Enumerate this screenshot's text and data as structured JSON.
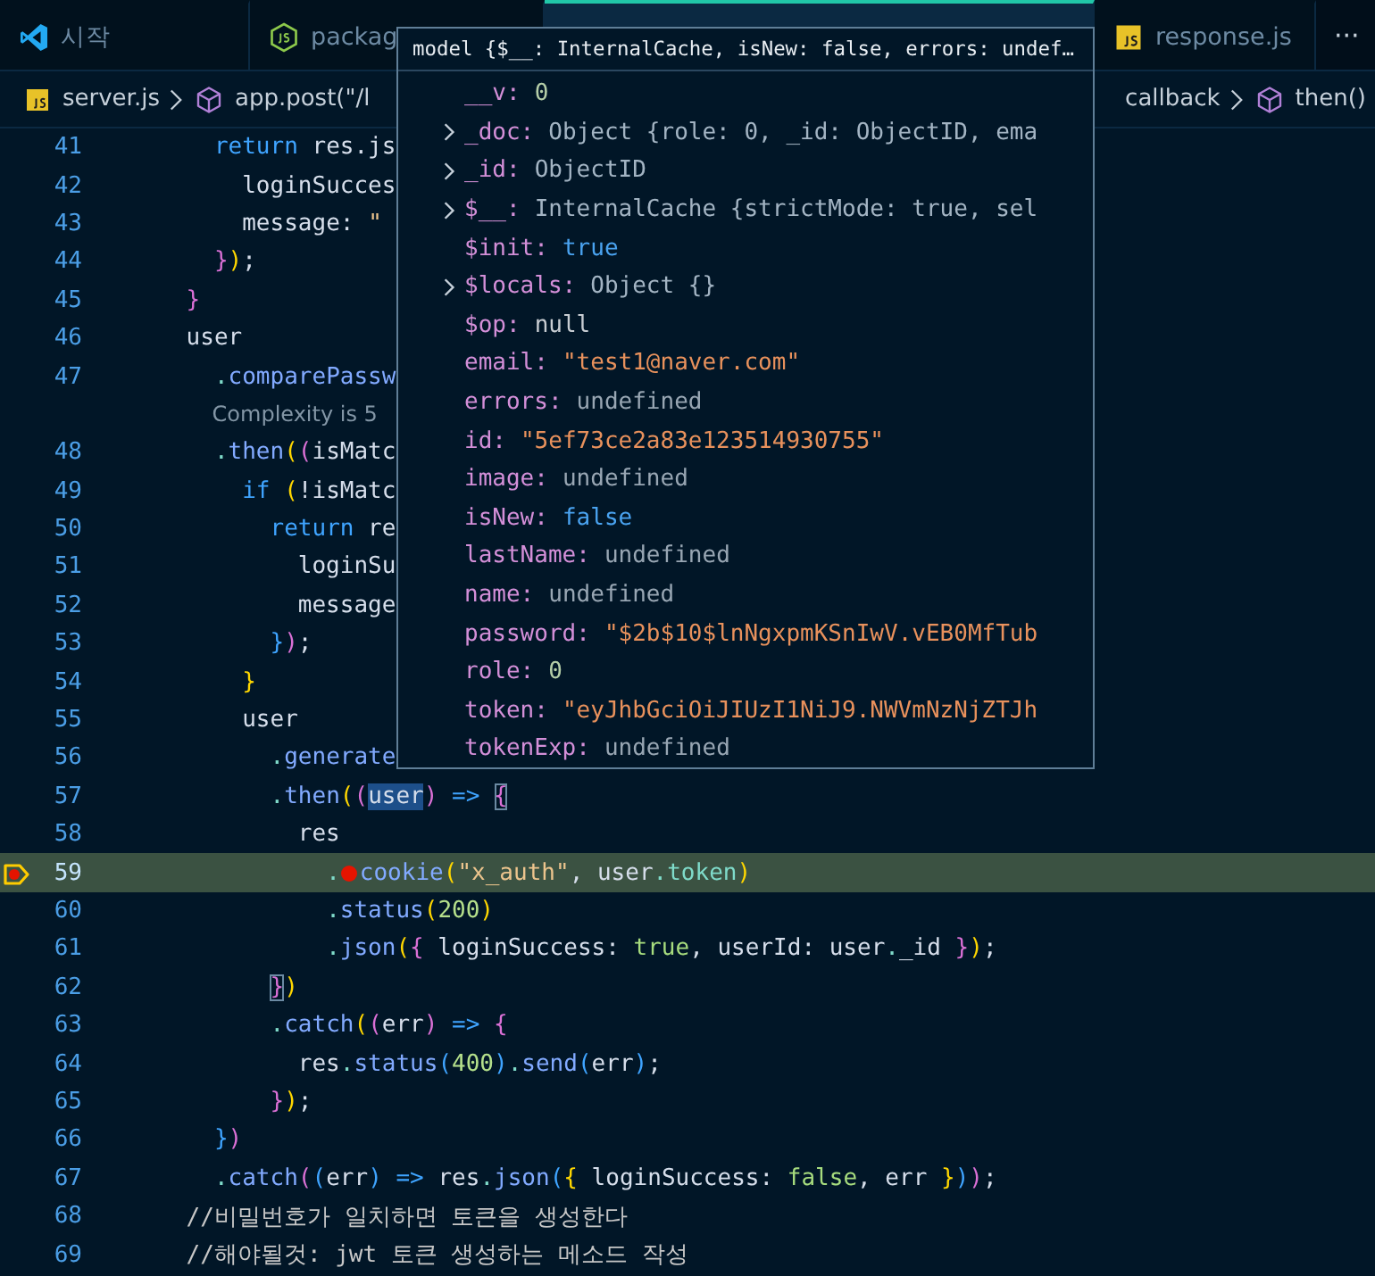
{
  "tabs": [
    {
      "label": "시작",
      "selected": false
    },
    {
      "label": "packag",
      "selected": false
    },
    {
      "selected": true
    },
    {
      "label": "response.js",
      "selected": false
    }
  ],
  "more_button": "···",
  "breadcrumbs": [
    {
      "label": "server.js"
    },
    {
      "label": "app.post(\"/l"
    },
    {
      "label": "callback"
    },
    {
      "label": "then()"
    }
  ],
  "lines": [
    {
      "kind": "code",
      "number": "41",
      "current": false,
      "breakpoint": false,
      "tokens": [
        {
          "text": "      return",
          "kind": "keyword"
        },
        {
          "text": " res.js",
          "kind": "plain"
        }
      ]
    },
    {
      "kind": "code",
      "number": "42",
      "current": false,
      "breakpoint": false,
      "tokens": [
        {
          "text": "        loginSucces",
          "kind": "plain"
        }
      ]
    },
    {
      "kind": "code",
      "number": "43",
      "current": false,
      "breakpoint": false,
      "tokens": [
        {
          "text": "        message",
          "kind": "plain"
        },
        {
          "text": ": ",
          "kind": "plain"
        },
        {
          "text": "\"",
          "kind": "string"
        }
      ]
    },
    {
      "kind": "code",
      "number": "44",
      "current": false,
      "breakpoint": false,
      "tokens": [
        {
          "text": "      }",
          "kind": "b2"
        },
        {
          "text": ")",
          "kind": "b1"
        },
        {
          "text": ";",
          "kind": "plain"
        }
      ]
    },
    {
      "kind": "code",
      "number": "45",
      "current": false,
      "breakpoint": false,
      "tokens": [
        {
          "text": "    }",
          "kind": "b2"
        }
      ]
    },
    {
      "kind": "code",
      "number": "46",
      "current": false,
      "breakpoint": false,
      "tokens": [
        {
          "text": "    user",
          "kind": "plain"
        }
      ]
    },
    {
      "kind": "code",
      "number": "47",
      "current": false,
      "breakpoint": false,
      "tokens": [
        {
          "text": "      .",
          "kind": "punct"
        },
        {
          "text": "comparePassw",
          "kind": "method"
        }
      ]
    },
    {
      "kind": "codelens",
      "text": "      Complexity is 5"
    },
    {
      "kind": "code",
      "number": "48",
      "current": false,
      "breakpoint": false,
      "tokens": [
        {
          "text": "      .",
          "kind": "punct"
        },
        {
          "text": "then",
          "kind": "method"
        },
        {
          "text": "(",
          "kind": "b1"
        },
        {
          "text": "(",
          "kind": "b2"
        },
        {
          "text": "isMatc",
          "kind": "plain"
        }
      ]
    },
    {
      "kind": "code",
      "number": "49",
      "current": false,
      "breakpoint": false,
      "tokens": [
        {
          "text": "        if",
          "kind": "keyword"
        },
        {
          "text": " (",
          "kind": "b1"
        },
        {
          "text": "!isMatc",
          "kind": "plain"
        }
      ]
    },
    {
      "kind": "code",
      "number": "50",
      "current": false,
      "breakpoint": false,
      "tokens": [
        {
          "text": "          return",
          "kind": "keyword"
        },
        {
          "text": " re",
          "kind": "plain"
        }
      ]
    },
    {
      "kind": "code",
      "number": "51",
      "current": false,
      "breakpoint": false,
      "tokens": [
        {
          "text": "            loginSu",
          "kind": "plain"
        }
      ]
    },
    {
      "kind": "code",
      "number": "52",
      "current": false,
      "breakpoint": false,
      "tokens": [
        {
          "text": "            message",
          "kind": "plain"
        }
      ]
    },
    {
      "kind": "code",
      "number": "53",
      "current": false,
      "breakpoint": false,
      "tokens": [
        {
          "text": "          }",
          "kind": "b3"
        },
        {
          "text": ")",
          "kind": "b2"
        },
        {
          "text": ";",
          "kind": "plain"
        }
      ]
    },
    {
      "kind": "code",
      "number": "54",
      "current": false,
      "breakpoint": false,
      "tokens": [
        {
          "text": "        }",
          "kind": "b1"
        }
      ]
    },
    {
      "kind": "code",
      "number": "55",
      "current": false,
      "breakpoint": false,
      "tokens": [
        {
          "text": "        user",
          "kind": "plain"
        }
      ]
    },
    {
      "kind": "code",
      "number": "56",
      "current": false,
      "breakpoint": false,
      "tokens": [
        {
          "text": "          .",
          "kind": "punct"
        },
        {
          "text": "generate",
          "kind": "method"
        }
      ]
    },
    {
      "kind": "code",
      "number": "57",
      "current": false,
      "breakpoint": false,
      "tokens": [
        {
          "text": "          .",
          "kind": "punct"
        },
        {
          "text": "then",
          "kind": "method"
        },
        {
          "text": "(",
          "kind": "b1"
        },
        {
          "text": "(",
          "kind": "b2"
        },
        {
          "text": "user",
          "kind": "selected"
        },
        {
          "text": ")",
          "kind": "b2"
        },
        {
          "text": " => ",
          "kind": "arrow"
        },
        {
          "text": "{",
          "kind": "match"
        }
      ]
    },
    {
      "kind": "code",
      "number": "58",
      "current": false,
      "breakpoint": false,
      "tokens": [
        {
          "text": "            res",
          "kind": "plain"
        }
      ]
    },
    {
      "kind": "code",
      "number": "59",
      "current": true,
      "breakpoint": true,
      "tokens": [
        {
          "text": "              .",
          "kind": "punct"
        },
        {
          "kind": "inline-breakpoint"
        },
        {
          "text": "cookie",
          "kind": "method"
        },
        {
          "text": "(",
          "kind": "b1"
        },
        {
          "text": "\"x_auth\"",
          "kind": "string"
        },
        {
          "text": ", user",
          "kind": "plain"
        },
        {
          "text": ".",
          "kind": "punct"
        },
        {
          "text": "token",
          "kind": "prop"
        },
        {
          "text": ")",
          "kind": "b1"
        }
      ]
    },
    {
      "kind": "code",
      "number": "60",
      "current": false,
      "breakpoint": false,
      "tokens": [
        {
          "text": "              .",
          "kind": "punct"
        },
        {
          "text": "status",
          "kind": "method"
        },
        {
          "text": "(",
          "kind": "b1"
        },
        {
          "text": "200",
          "kind": "number"
        },
        {
          "text": ")",
          "kind": "b1"
        }
      ]
    },
    {
      "kind": "code",
      "number": "61",
      "current": false,
      "breakpoint": false,
      "tokens": [
        {
          "text": "              .",
          "kind": "punct"
        },
        {
          "text": "json",
          "kind": "method"
        },
        {
          "text": "(",
          "kind": "b1"
        },
        {
          "text": "{",
          "kind": "b2"
        },
        {
          "text": " loginSuccess: ",
          "kind": "plain"
        },
        {
          "text": "true",
          "kind": "bool"
        },
        {
          "text": ", userId: user",
          "kind": "plain"
        },
        {
          "text": ".",
          "kind": "punct"
        },
        {
          "text": "_id ",
          "kind": "plain"
        },
        {
          "text": "}",
          "kind": "b2"
        },
        {
          "text": ")",
          "kind": "b1"
        },
        {
          "text": ";",
          "kind": "plain"
        }
      ]
    },
    {
      "kind": "code",
      "number": "62",
      "current": false,
      "breakpoint": false,
      "tokens": [
        {
          "text": "          }",
          "kind": "match"
        },
        {
          "text": ")",
          "kind": "b1"
        }
      ]
    },
    {
      "kind": "code",
      "number": "63",
      "current": false,
      "breakpoint": false,
      "tokens": [
        {
          "text": "          .",
          "kind": "punct"
        },
        {
          "text": "catch",
          "kind": "method"
        },
        {
          "text": "(",
          "kind": "b1"
        },
        {
          "text": "(",
          "kind": "b2"
        },
        {
          "text": "err",
          "kind": "plain"
        },
        {
          "text": ")",
          "kind": "b2"
        },
        {
          "text": " => ",
          "kind": "arrow"
        },
        {
          "text": "{",
          "kind": "b2"
        }
      ]
    },
    {
      "kind": "code",
      "number": "64",
      "current": false,
      "breakpoint": false,
      "tokens": [
        {
          "text": "            res",
          "kind": "plain"
        },
        {
          "text": ".",
          "kind": "punct"
        },
        {
          "text": "status",
          "kind": "method"
        },
        {
          "text": "(",
          "kind": "b3"
        },
        {
          "text": "400",
          "kind": "number"
        },
        {
          "text": ")",
          "kind": "b3"
        },
        {
          "text": ".",
          "kind": "punct"
        },
        {
          "text": "send",
          "kind": "method"
        },
        {
          "text": "(",
          "kind": "b3"
        },
        {
          "text": "err",
          "kind": "plain"
        },
        {
          "text": ")",
          "kind": "b3"
        },
        {
          "text": ";",
          "kind": "plain"
        }
      ]
    },
    {
      "kind": "code",
      "number": "65",
      "current": false,
      "breakpoint": false,
      "tokens": [
        {
          "text": "          }",
          "kind": "b2"
        },
        {
          "text": ")",
          "kind": "b1"
        },
        {
          "text": ";",
          "kind": "plain"
        }
      ]
    },
    {
      "kind": "code",
      "number": "66",
      "current": false,
      "breakpoint": false,
      "tokens": [
        {
          "text": "      }",
          "kind": "b3"
        },
        {
          "text": ")",
          "kind": "b2"
        }
      ]
    },
    {
      "kind": "code",
      "number": "67",
      "current": false,
      "breakpoint": false,
      "tokens": [
        {
          "text": "      .",
          "kind": "punct"
        },
        {
          "text": "catch",
          "kind": "method"
        },
        {
          "text": "(",
          "kind": "b2"
        },
        {
          "text": "(",
          "kind": "b3"
        },
        {
          "text": "err",
          "kind": "plain"
        },
        {
          "text": ")",
          "kind": "b3"
        },
        {
          "text": " => ",
          "kind": "arrow"
        },
        {
          "text": "res",
          "kind": "plain"
        },
        {
          "text": ".",
          "kind": "punct"
        },
        {
          "text": "json",
          "kind": "method"
        },
        {
          "text": "(",
          "kind": "b3"
        },
        {
          "text": "{",
          "kind": "b1"
        },
        {
          "text": " loginSuccess: ",
          "kind": "plain"
        },
        {
          "text": "false",
          "kind": "bool"
        },
        {
          "text": ", err ",
          "kind": "plain"
        },
        {
          "text": "}",
          "kind": "b1"
        },
        {
          "text": ")",
          "kind": "b3"
        },
        {
          "text": ")",
          "kind": "b2"
        },
        {
          "text": ";",
          "kind": "plain"
        }
      ]
    },
    {
      "kind": "code",
      "number": "68",
      "current": false,
      "breakpoint": false,
      "tokens": [
        {
          "text": "    //비밀번호가 일치하면 토큰을 생성한다",
          "kind": "comment"
        }
      ]
    },
    {
      "kind": "code",
      "number": "69",
      "current": false,
      "breakpoint": false,
      "tokens": [
        {
          "text": "    //해야될것: jwt 토큰 생성하는 메소드 작성",
          "kind": "comment"
        }
      ]
    }
  ],
  "hover": {
    "title": "model {$__: InternalCache, isNew: false, errors: undef…",
    "rows": [
      {
        "key": "__v:",
        "value": "0",
        "kind": "number",
        "expandable": false
      },
      {
        "key": "_doc:",
        "value": "Object {role: 0, _id: ObjectID, ema",
        "kind": "object",
        "expandable": true
      },
      {
        "key": "_id:",
        "value": "ObjectID",
        "kind": "object",
        "expandable": true
      },
      {
        "key": "$__:",
        "value": "InternalCache {strictMode: true, sel",
        "kind": "object",
        "expandable": true
      },
      {
        "key": "$init:",
        "value": "true",
        "kind": "bool",
        "expandable": false
      },
      {
        "key": "$locals:",
        "value": "Object {}",
        "kind": "object",
        "expandable": true
      },
      {
        "key": "$op:",
        "value": "null",
        "kind": "null",
        "expandable": false
      },
      {
        "key": "email:",
        "value": "\"test1@naver.com\"",
        "kind": "string",
        "expandable": false
      },
      {
        "key": "errors:",
        "value": "undefined",
        "kind": "undefined",
        "expandable": false
      },
      {
        "key": "id:",
        "value": "\"5ef73ce2a83e123514930755\"",
        "kind": "string",
        "expandable": false
      },
      {
        "key": "image:",
        "value": "undefined",
        "kind": "undefined",
        "expandable": false
      },
      {
        "key": "isNew:",
        "value": "false",
        "kind": "bool",
        "expandable": false
      },
      {
        "key": "lastName:",
        "value": "undefined",
        "kind": "undefined",
        "expandable": false
      },
      {
        "key": "name:",
        "value": "undefined",
        "kind": "undefined",
        "expandable": false
      },
      {
        "key": "password:",
        "value": "\"$2b$10$lnNgxpmKSnIwV.vEB0MfTub",
        "kind": "string",
        "expandable": false
      },
      {
        "key": "role:",
        "value": "0",
        "kind": "number",
        "expandable": false
      },
      {
        "key": "token:",
        "value": "\"eyJhbGciOiJIUzI1NiJ9.NWVmNzNjZTJh",
        "kind": "string",
        "expandable": false
      },
      {
        "key": "tokenExp:",
        "value": "undefined",
        "kind": "undefined",
        "expandable": false
      }
    ]
  }
}
